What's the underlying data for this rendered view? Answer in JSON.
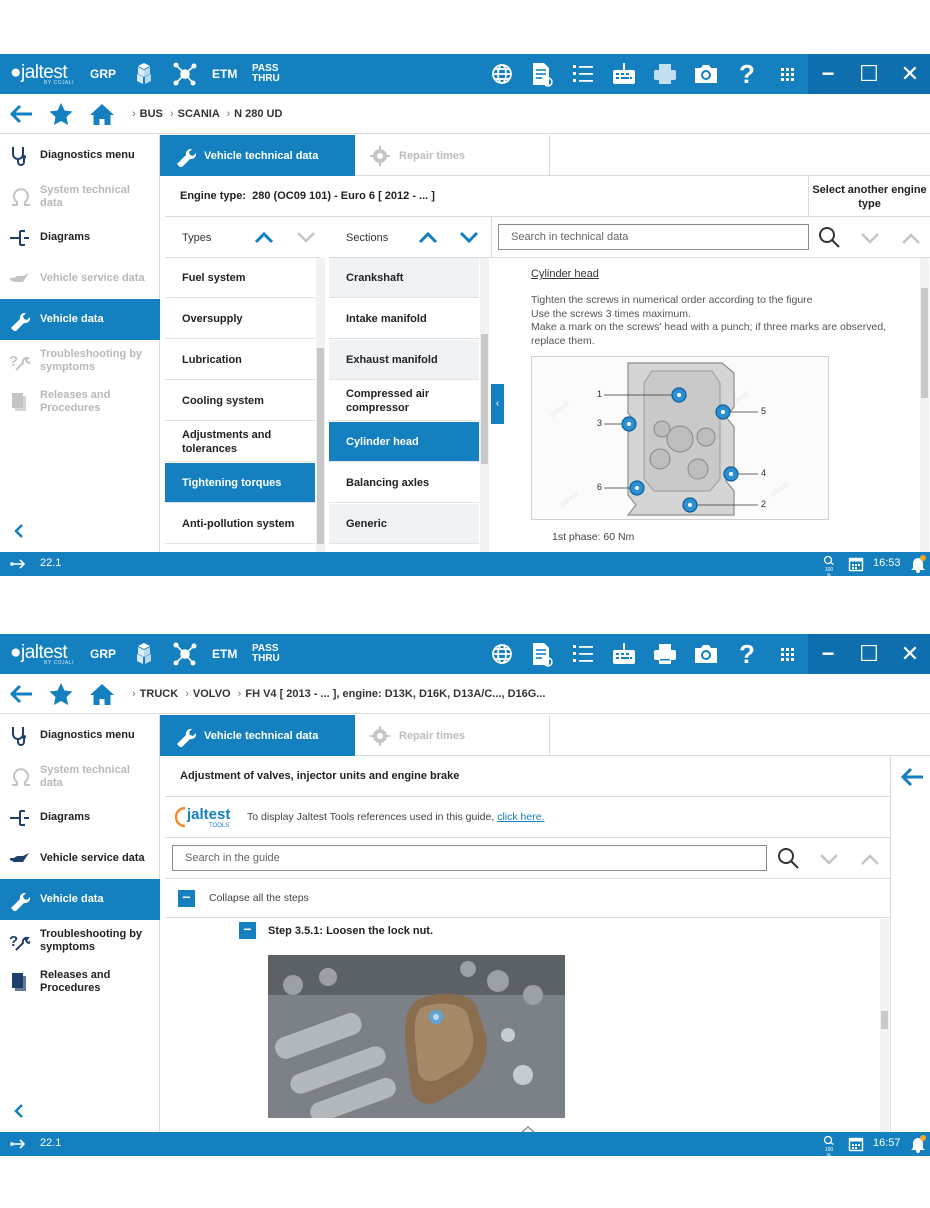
{
  "screen1": {
    "topbar": {
      "logo_brand": "jaltest",
      "logo_sub": "BY COJALI",
      "grp_label": "GRP",
      "etm_label": "ETM",
      "pass_label": "PASS",
      "thru_label": "THRU",
      "icons": [
        "vehicle-group-icon",
        "molecule-icon",
        "globe-icon",
        "document-icon",
        "list-icon",
        "keyboard-icon",
        "printer-icon",
        "camera-icon",
        "help-icon",
        "apps-grid-icon"
      ],
      "window_controls": [
        "minimize",
        "maximize",
        "close"
      ]
    },
    "navbar": {
      "breadcrumb": [
        "BUS",
        "SCANIA",
        "N 280 UD"
      ]
    },
    "sidebar": {
      "items": [
        {
          "label": "Diagnostics menu",
          "state": "normal",
          "icon": "stethoscope-icon"
        },
        {
          "label": "System technical data",
          "state": "disabled",
          "icon": "ohm-icon"
        },
        {
          "label": "Diagrams",
          "state": "normal",
          "icon": "diagram-icon"
        },
        {
          "label": "Vehicle service data",
          "state": "disabled",
          "icon": "oil-can-icon"
        },
        {
          "label": "Vehicle data",
          "state": "active",
          "icon": "wrench-icon"
        },
        {
          "label": "Troubleshooting by symptoms",
          "state": "disabled",
          "icon": "troubleshoot-icon"
        },
        {
          "label": "Releases and Procedures",
          "state": "disabled",
          "icon": "procedures-icon"
        }
      ]
    },
    "tabs": [
      {
        "label": "Vehicle technical data",
        "active": true
      },
      {
        "label": "Repair times",
        "active": false
      }
    ],
    "engine": {
      "label": "Engine type:",
      "value": "280 (OC09 101) - Euro 6 [ 2012 - ... ]",
      "select_button": "Select another engine type"
    },
    "types_column": {
      "header": "Types",
      "items": [
        "Fuel system",
        "Oversupply",
        "Lubrication",
        "Cooling system",
        "Adjustments and tolerances",
        "Tightening torques",
        "Anti-pollution system"
      ],
      "selected": "Tightening torques"
    },
    "sections_column": {
      "header": "Sections",
      "items": [
        "Crankshaft",
        "Intake manifold",
        "Exhaust manifold",
        "Compressed air compressor",
        "Cylinder head",
        "Balancing axles",
        "Generic"
      ],
      "selected": "Cylinder head"
    },
    "search": {
      "placeholder": "Search in technical data"
    },
    "document": {
      "title": "Cylinder head",
      "lines": [
        "Tighten the screws in numerical order according to the figure",
        "Use the screws 3 times maximum.",
        "Make a mark on the screws' head with a punch; if three marks are observed, replace them."
      ],
      "figure_labels": [
        "1",
        "2",
        "3",
        "4",
        "5",
        "6"
      ],
      "phase": "1st phase: 60 Nm"
    },
    "statusbar": {
      "version": "22.1",
      "zoom": "100 %",
      "time": "16:53"
    }
  },
  "screen2": {
    "topbar": {
      "logo_brand": "jaltest",
      "logo_sub": "BY COJALI",
      "grp_label": "GRP",
      "etm_label": "ETM",
      "pass_label": "PASS",
      "thru_label": "THRU"
    },
    "navbar": {
      "breadcrumb": [
        "TRUCK",
        "VOLVO",
        "FH V4 [ 2013 - ... ], engine: D13K, D16K, D13A/C..., D16G..."
      ]
    },
    "sidebar": {
      "items": [
        {
          "label": "Diagnostics menu",
          "state": "normal",
          "icon": "stethoscope-icon"
        },
        {
          "label": "System technical data",
          "state": "disabled",
          "icon": "ohm-icon"
        },
        {
          "label": "Diagrams",
          "state": "normal",
          "icon": "diagram-icon"
        },
        {
          "label": "Vehicle service data",
          "state": "normal",
          "icon": "oil-can-icon"
        },
        {
          "label": "Vehicle data",
          "state": "active",
          "icon": "wrench-icon"
        },
        {
          "label": "Troubleshooting by symptoms",
          "state": "normal",
          "icon": "troubleshoot-icon"
        },
        {
          "label": "Releases and Procedures",
          "state": "normal",
          "icon": "procedures-icon"
        }
      ]
    },
    "tabs": [
      {
        "label": "Vehicle technical data",
        "active": true
      },
      {
        "label": "Repair times",
        "active": false
      }
    ],
    "guide": {
      "title": "Adjustment of valves, injector units and engine brake",
      "tools_logo": "jaltest",
      "tools_logo_sub": "TOOLS",
      "tools_text": "To display Jaltest Tools references used in this guide,",
      "tools_link": "click here.",
      "search_placeholder": "Search in the guide",
      "collapse_label": "Collapse all the steps",
      "step_label": "Step 3.5.1: Loosen the lock nut."
    },
    "statusbar": {
      "version": "22.1",
      "zoom": "100 %",
      "time": "16:57"
    }
  },
  "colors": {
    "accent": "#1480c0",
    "accent_dark": "#0f6fae",
    "disabled_text": "#b8b8b8",
    "alt_row": "#f0f3f6"
  }
}
